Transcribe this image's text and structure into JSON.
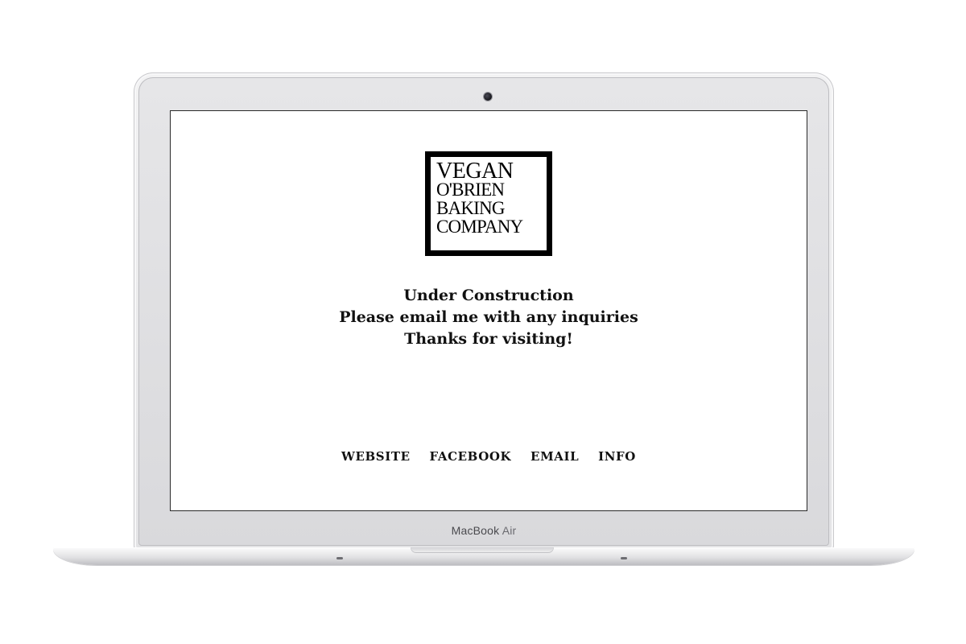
{
  "device": {
    "brand": "MacBook",
    "model": "Air"
  },
  "logo": {
    "lines": [
      "VEGAN",
      "O'BRIEN",
      "BAKING",
      "COMPANY"
    ]
  },
  "message": {
    "line1": "Under Construction",
    "line2": "Please email me with any inquiries",
    "line3": "Thanks for visiting!"
  },
  "nav": {
    "items": [
      {
        "label": "WEBSITE"
      },
      {
        "label": "FACEBOOK"
      },
      {
        "label": "EMAIL"
      },
      {
        "label": "INFO"
      }
    ]
  },
  "colors": {
    "background": "#ffffff",
    "text": "#111111",
    "logo_frame": "#000000",
    "laptop_silver": "#e3e3e5"
  }
}
